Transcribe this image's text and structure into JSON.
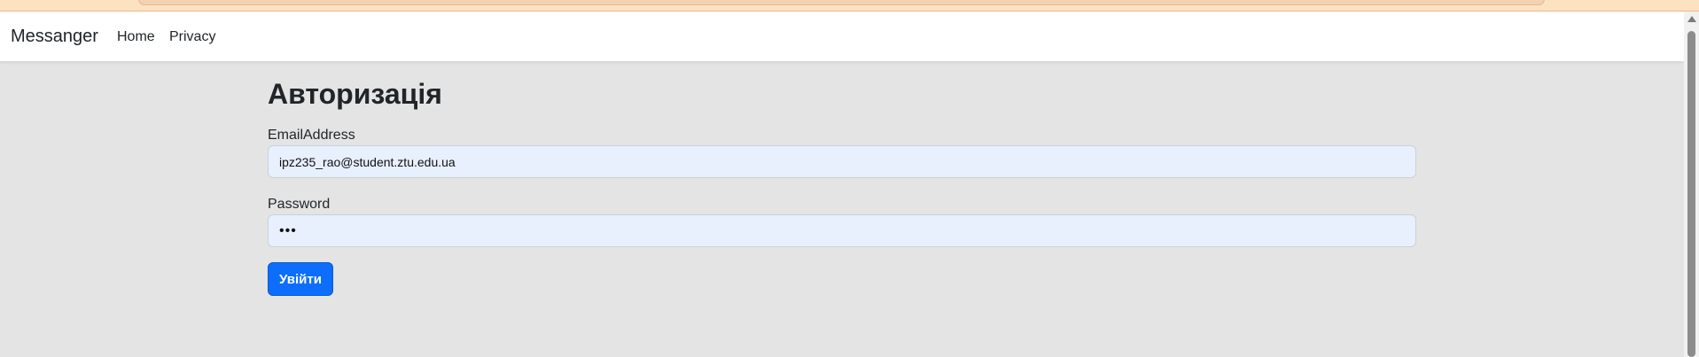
{
  "navbar": {
    "brand": "Messanger",
    "links": [
      {
        "label": "Home"
      },
      {
        "label": "Privacy"
      }
    ]
  },
  "main": {
    "title": "Авторизація",
    "email": {
      "label": "EmailAddress",
      "value": "ipz235_rao@student.ztu.edu.ua"
    },
    "password": {
      "label": "Password",
      "value": "•••"
    },
    "submit_label": "Увійти"
  },
  "colors": {
    "primary": "#0d6efd",
    "background": "#e4e4e4",
    "autofill": "#e8f0fe"
  }
}
